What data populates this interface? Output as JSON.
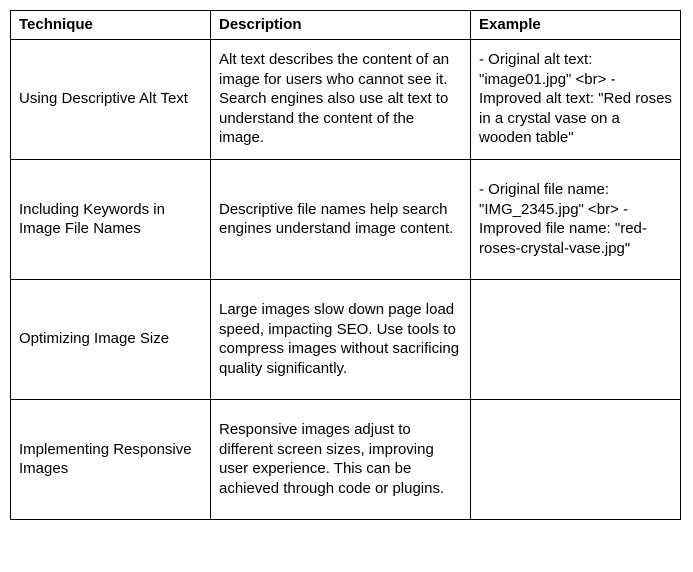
{
  "table": {
    "headers": {
      "technique": "Technique",
      "description": "Description",
      "example": "Example"
    },
    "rows": [
      {
        "technique": "Using Descriptive Alt Text",
        "description": "Alt text describes the content of an image for users who cannot see it. Search engines also use alt text to understand the content of the image.",
        "example": "- Original alt text: \"image01.jpg\" <br> - Improved alt text: \"Red roses in a crystal vase on a wooden table\""
      },
      {
        "technique": "Including Keywords in Image File Names",
        "description": "Descriptive file names help search engines understand image content.",
        "example": "- Original file name: \"IMG_2345.jpg\" <br> - Improved file name: \"red-roses-crystal-vase.jpg\""
      },
      {
        "technique": "Optimizing Image Size",
        "description": "Large images slow down page load speed, impacting SEO. Use tools to compress images without sacrificing quality significantly.",
        "example": ""
      },
      {
        "technique": "Implementing Responsive Images",
        "description": "Responsive images adjust to different screen sizes, improving user experience. This can be achieved through code or plugins.",
        "example": ""
      }
    ]
  }
}
